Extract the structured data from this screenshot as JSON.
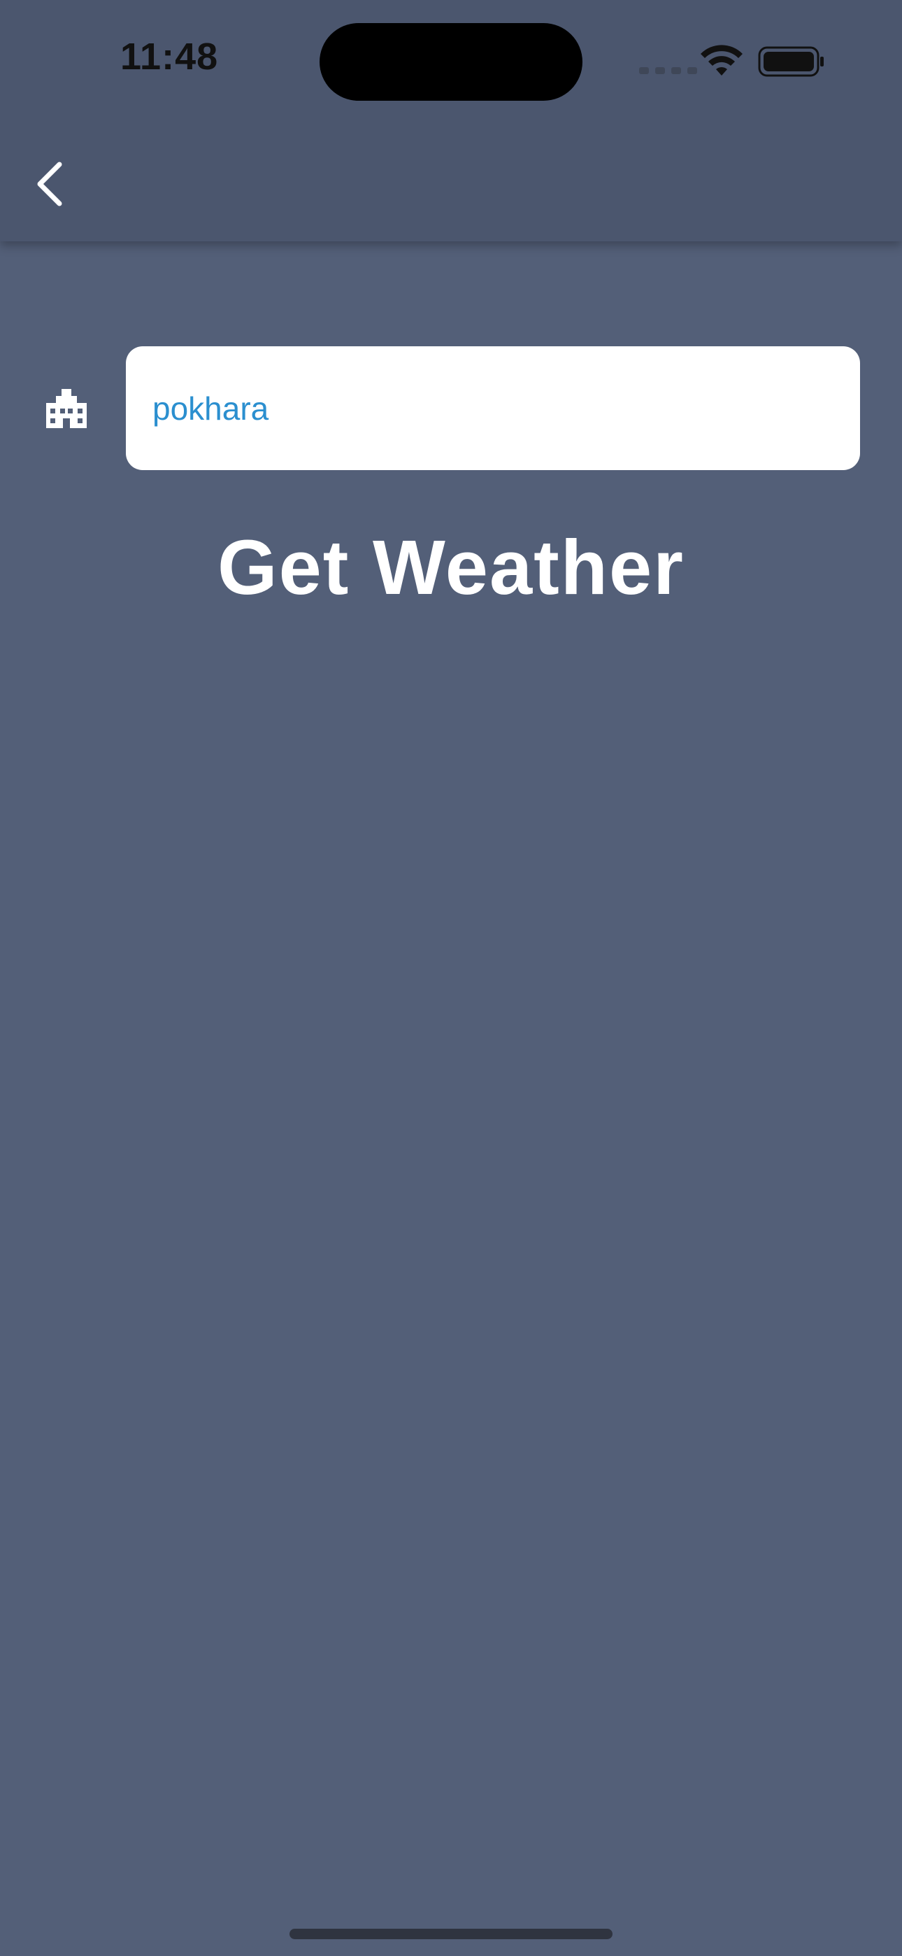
{
  "status_bar": {
    "time": "11:48",
    "icons": [
      "cellular-signal-icon",
      "wifi-icon",
      "battery-icon"
    ]
  },
  "app_bar": {
    "back_icon": "chevron-left-icon"
  },
  "form": {
    "field_icon": "location-city-icon",
    "city_input_value": "pokhara",
    "submit_label": "Get Weather"
  },
  "colors": {
    "background": "#535f78",
    "app_bar": "#4b566e",
    "input_background": "#ffffff",
    "input_text": "#2b8fcf",
    "button_text": "#ffffff"
  }
}
